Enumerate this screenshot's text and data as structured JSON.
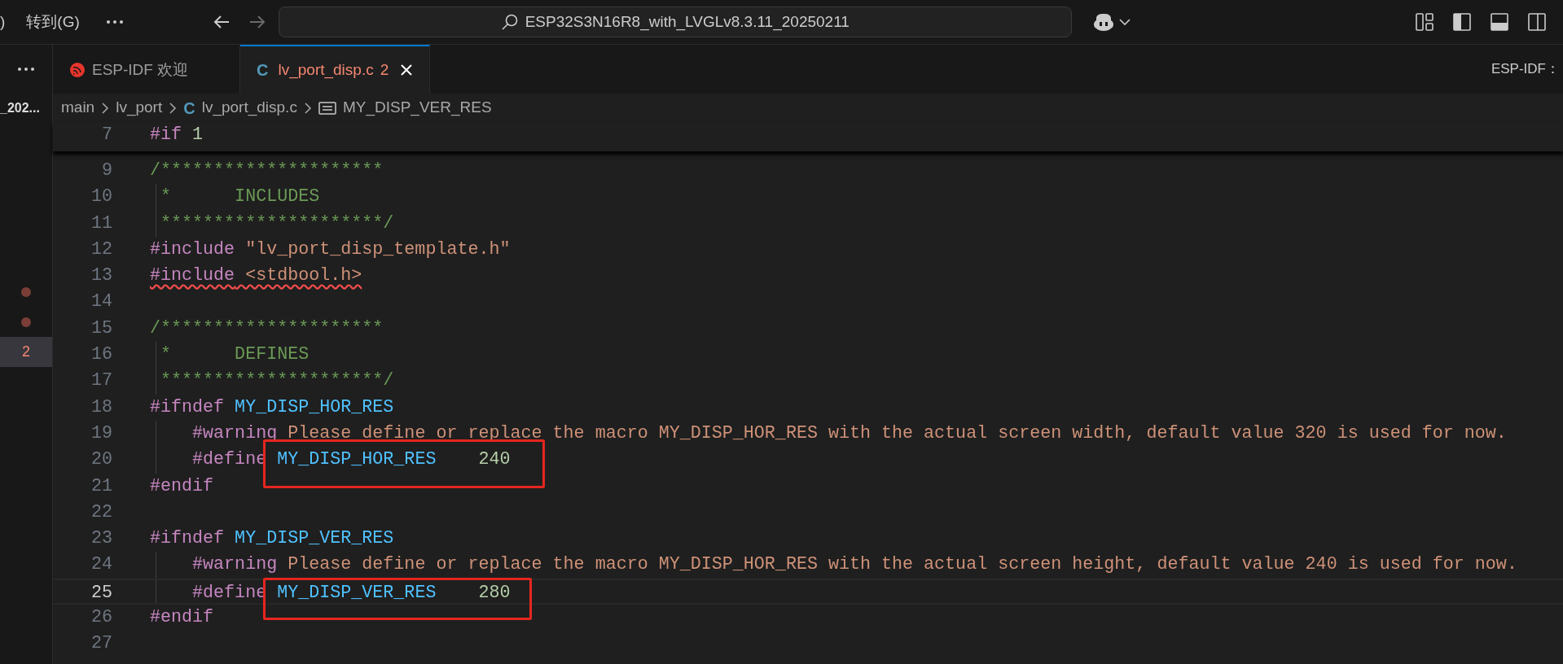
{
  "title_bar": {
    "menu_items": [
      ")",
      "转到(G)"
    ],
    "search": {
      "value": "ESP32S3N16R8_with_LVGLv8.3.11_20250211"
    }
  },
  "sidebar": {
    "title": "_202...",
    "rows": [
      {
        "kind": "dot",
        "selected": false
      },
      {
        "kind": "dot",
        "selected": false
      },
      {
        "kind": "count",
        "text": "2",
        "selected": true
      }
    ]
  },
  "tabs": [
    {
      "kind": "espidf",
      "label": "ESP-IDF 欢迎",
      "selected": false
    },
    {
      "kind": "c",
      "icon_text": "C",
      "label": "lv_port_disp.c",
      "badge": "2",
      "selected": true
    }
  ],
  "tab_bar_right": "ESP-IDF：",
  "breadcrumb": [
    {
      "kind": "folder",
      "text": "main"
    },
    {
      "kind": "folder",
      "text": "lv_port"
    },
    {
      "kind": "c",
      "icon_text": "C",
      "text": "lv_port_disp.c"
    },
    {
      "kind": "symbol",
      "text": "MY_DISP_VER_RES"
    }
  ],
  "sticky_line": {
    "number": "7",
    "segments": [
      {
        "kind": "directive",
        "text": "#if"
      },
      {
        "kind": "number",
        "text": " 1"
      }
    ]
  },
  "lines": [
    {
      "number": "9",
      "segments": [
        {
          "kind": "comment",
          "text": "/*********************"
        }
      ]
    },
    {
      "number": "10",
      "segments": [
        {
          "kind": "comment",
          "text": " *      INCLUDES"
        }
      ],
      "guide": true
    },
    {
      "number": "11",
      "segments": [
        {
          "kind": "comment",
          "text": " *********************/"
        }
      ],
      "guide": true
    },
    {
      "number": "12",
      "segments": [
        {
          "kind": "directive",
          "text": "#include"
        },
        {
          "kind": "string",
          "text": " \"lv_port_disp_template.h\""
        }
      ]
    },
    {
      "number": "13",
      "error": true,
      "segments": [
        {
          "kind": "directive",
          "text": "#include"
        },
        {
          "kind": "string",
          "text": " <stdbool.h>"
        }
      ]
    },
    {
      "number": "14"
    },
    {
      "number": "15",
      "segments": [
        {
          "kind": "comment",
          "text": "/*********************"
        }
      ]
    },
    {
      "number": "16",
      "segments": [
        {
          "kind": "comment",
          "text": " *      DEFINES"
        }
      ],
      "guide": true
    },
    {
      "number": "17",
      "segments": [
        {
          "kind": "comment",
          "text": " *********************/"
        }
      ],
      "guide": true
    },
    {
      "number": "18",
      "segments": [
        {
          "kind": "directive",
          "text": "#ifndef"
        },
        {
          "kind": "macro",
          "text": " MY_DISP_HOR_RES"
        }
      ]
    },
    {
      "number": "19",
      "segments": [
        {
          "kind": "directive",
          "text": "    #warning"
        },
        {
          "kind": "string",
          "text": " Please define or replace the macro MY_DISP_HOR_RES with the actual screen width, default value 320 is used for now."
        }
      ],
      "guide": true
    },
    {
      "number": "20",
      "boxed": true,
      "segments": [
        {
          "kind": "directive",
          "text": "    #define"
        },
        {
          "kind": "macro",
          "text": " MY_DISP_HOR_RES"
        },
        {
          "kind": "number",
          "text": "    240"
        }
      ],
      "guide": true
    },
    {
      "number": "21",
      "segments": [
        {
          "kind": "directive",
          "text": "#endif"
        }
      ]
    },
    {
      "number": "22"
    },
    {
      "number": "23",
      "segments": [
        {
          "kind": "directive",
          "text": "#ifndef"
        },
        {
          "kind": "macro",
          "text": " MY_DISP_VER_RES"
        }
      ]
    },
    {
      "number": "24",
      "segments": [
        {
          "kind": "directive",
          "text": "    #warning"
        },
        {
          "kind": "string",
          "text": " Please define or replace the macro MY_DISP_HOR_RES with the actual screen height, default value 240 is used for now."
        }
      ],
      "guide": true
    },
    {
      "number": "25",
      "current": true,
      "boxed": true,
      "segments": [
        {
          "kind": "directive",
          "text": "    #define"
        },
        {
          "kind": "macro",
          "text": " MY_DISP_VER_RES"
        },
        {
          "kind": "number",
          "text": "    280"
        }
      ],
      "guide": true
    },
    {
      "number": "26",
      "segments": [
        {
          "kind": "directive",
          "text": "#endif"
        }
      ]
    },
    {
      "number": "27"
    }
  ]
}
